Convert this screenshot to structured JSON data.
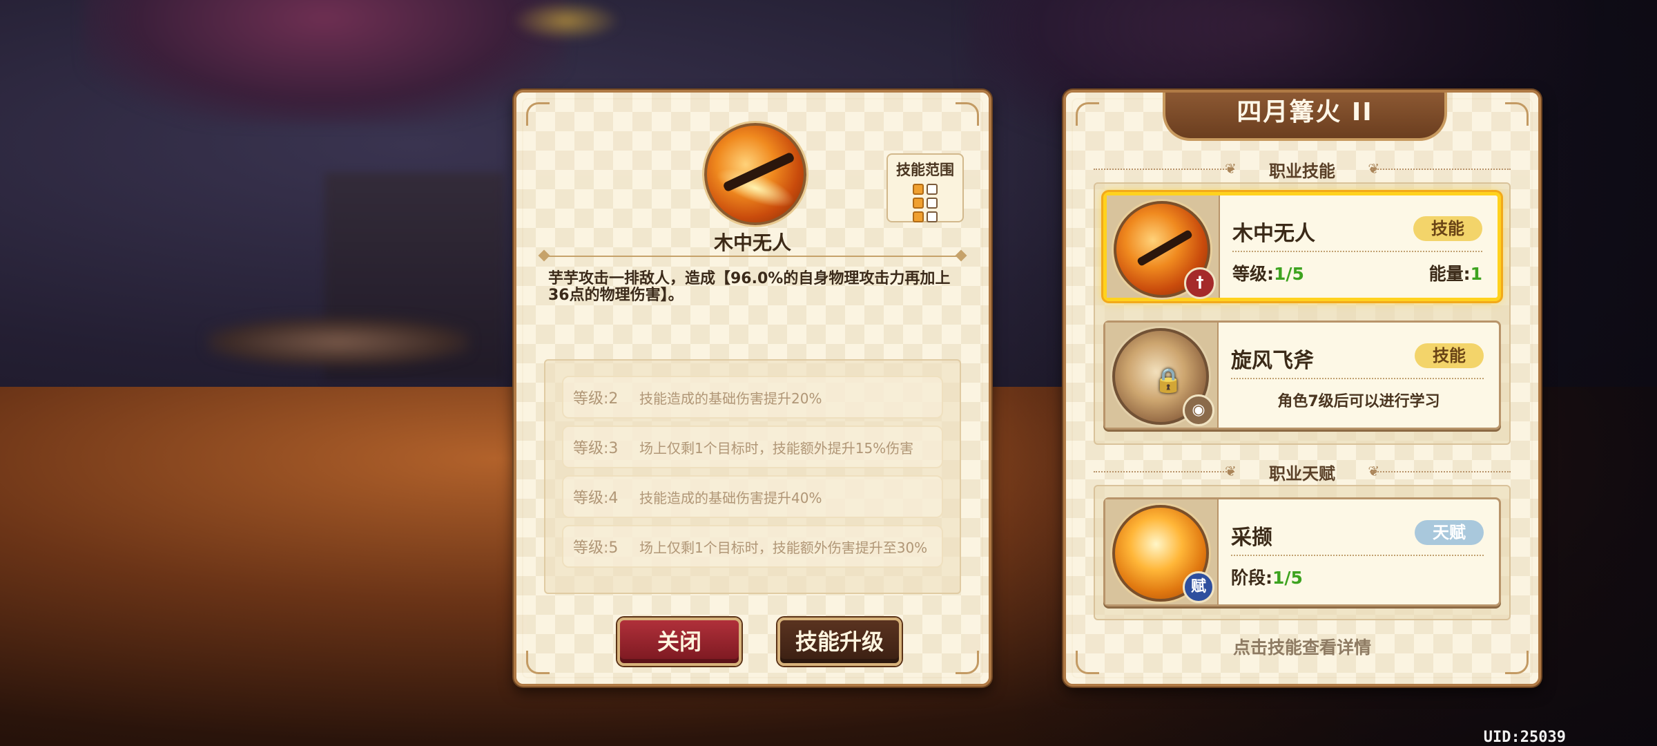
{
  "detail": {
    "skill_name": "木中无人",
    "range_label": "技能范围",
    "description": "芋芋攻击一排敌人，造成【96.0%的自身物理攻击力再加上36点的物理伤害】。",
    "levels": [
      {
        "label": "等级:2",
        "text": "技能造成的基础伤害提升20%"
      },
      {
        "label": "等级:3",
        "text": "场上仅剩1个目标时，技能额外提升15%伤害"
      },
      {
        "label": "等级:4",
        "text": "技能造成的基础伤害提升40%"
      },
      {
        "label": "等级:5",
        "text": "场上仅剩1个目标时，技能额外伤害提升至30%"
      }
    ],
    "close_label": "关闭",
    "upgrade_label": "技能升级"
  },
  "list": {
    "title": "四月篝火 II",
    "class_skills_heading": "职业技能",
    "class_talent_heading": "职业天赋",
    "skills": [
      {
        "name": "木中无人",
        "tag": "技能",
        "level_label": "等级:",
        "level_value": "1/5",
        "energy_label": "能量:",
        "energy_value": "1",
        "badge": "",
        "icon": "axe-strike-icon"
      },
      {
        "name": "旋风飞斧",
        "tag": "技能",
        "locked_text": "角色7级后可以进行学习",
        "icon": "whirlwind-axe-icon"
      }
    ],
    "talent": {
      "name": "采撷",
      "tag": "天赋",
      "stage_label": "阶段:",
      "stage_value": "1/5",
      "badge": "赋",
      "icon": "harvest-icon"
    },
    "hint": "点击技能查看详情"
  },
  "uid": "UID:25039",
  "colors": {
    "selected_border": "#ffd21e",
    "green_value": "#3da31f",
    "close_button": "#b0303a"
  }
}
